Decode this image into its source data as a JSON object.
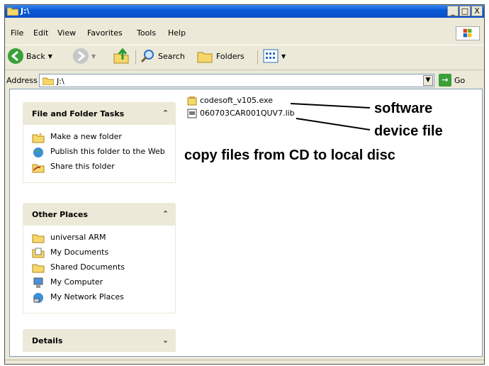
{
  "window": {
    "title": "J:\\",
    "minimize_glyph": "_",
    "maximize_glyph": "□",
    "close_glyph": "X"
  },
  "menu": [
    "File",
    "Edit",
    "View",
    "Favorites",
    "Tools",
    "Help"
  ],
  "toolbar": {
    "back_label": "Back",
    "search_label": "Search",
    "folders_label": "Folders"
  },
  "address": {
    "label": "Address",
    "value": "J:\\",
    "go_label": "Go"
  },
  "tasks_panel": {
    "title": "File and Folder Tasks",
    "items": [
      {
        "label": "Make a new folder",
        "icon": "new-folder-icon"
      },
      {
        "label": "Publish this folder to the Web",
        "icon": "publish-web-icon"
      },
      {
        "label": "Share this folder",
        "icon": "share-folder-icon"
      }
    ]
  },
  "places_panel": {
    "title": "Other Places",
    "items": [
      {
        "label": "universal ARM",
        "icon": "folder-icon"
      },
      {
        "label": "My Documents",
        "icon": "my-documents-icon"
      },
      {
        "label": "Shared Documents",
        "icon": "folder-icon"
      },
      {
        "label": "My Computer",
        "icon": "my-computer-icon"
      },
      {
        "label": "My Network Places",
        "icon": "network-places-icon"
      }
    ]
  },
  "details_panel": {
    "title": "Details"
  },
  "files": [
    {
      "name": "codesoft_v105.exe",
      "icon": "installer-icon"
    },
    {
      "name": "060703CAR001QUV7.lib",
      "icon": "lib-file-icon"
    }
  ],
  "annotations": {
    "software": "software",
    "device_file": "device file",
    "instruction": "copy files from CD to local disc"
  },
  "colors": {
    "titlebar": "#0a5ad8",
    "chrome": "#ece9d8",
    "go_green": "#3aa03a"
  }
}
